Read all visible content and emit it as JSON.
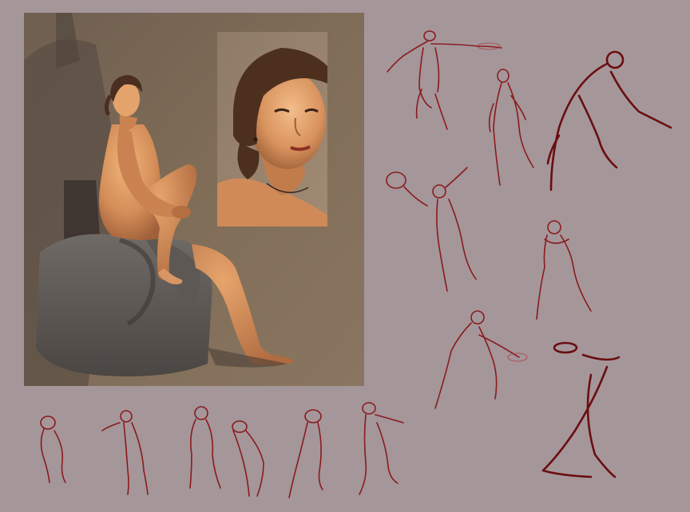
{
  "image": {
    "background_color": "#a5969a",
    "subjects": {
      "painting": "seated-figure-painting",
      "portrait": "portrait-inset",
      "sketches": "gesture-sketches"
    },
    "colors": {
      "painting_background": "#7d6a55",
      "skin": "#d9935e",
      "sketch_line": "#8a1b1d"
    }
  }
}
